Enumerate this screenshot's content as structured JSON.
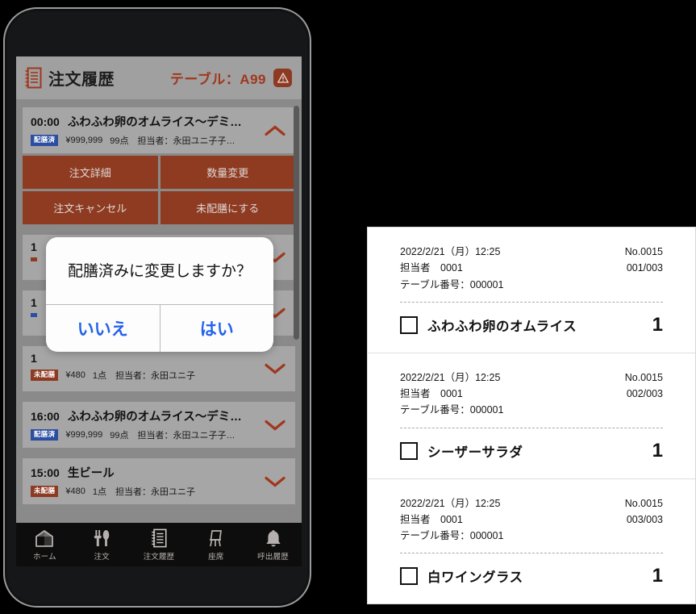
{
  "app": {
    "title": "注文履歴",
    "table_label": "テーブル：A99",
    "notebook_icon": "notebook-icon",
    "alert_icon": "warning-triangle-icon"
  },
  "orders": [
    {
      "time": "00:00",
      "name": "ふわふわ卵のオムライス～デミ…",
      "status": "配膳済",
      "status_type": "served",
      "price": "¥999,999",
      "count": "99点",
      "staff": "担当者：永田ユニ子子…",
      "expanded": true,
      "chevron": "chevron-up-icon",
      "actions": [
        "注文詳細",
        "数量変更",
        "注文キャンセル",
        "未配膳にする"
      ]
    },
    {
      "time": "1",
      "name": "",
      "status": "",
      "status_type": "unserved",
      "price": "",
      "count": "",
      "staff": "",
      "expanded": false,
      "chevron": "chevron-down-icon",
      "actions": []
    },
    {
      "time": "1",
      "name": "",
      "status": "",
      "status_type": "served",
      "price": "",
      "count": "",
      "staff": "",
      "expanded": false,
      "chevron": "chevron-down-icon",
      "actions": []
    },
    {
      "time": "1",
      "name": "",
      "status": "未配膳",
      "status_type": "unserved",
      "price": "¥480",
      "count": "1点",
      "staff": "担当者：永田ユニ子",
      "expanded": false,
      "chevron": "chevron-down-icon",
      "actions": []
    },
    {
      "time": "16:00",
      "name": "ふわふわ卵のオムライス～デミ…",
      "status": "配膳済",
      "status_type": "served",
      "price": "¥999,999",
      "count": "99点",
      "staff": "担当者：永田ユニ子子…",
      "expanded": false,
      "chevron": "chevron-down-icon",
      "actions": []
    },
    {
      "time": "15:00",
      "name": "生ビール",
      "status": "未配膳",
      "status_type": "unserved",
      "price": "¥480",
      "count": "1点",
      "staff": "担当者：永田ユニ子",
      "expanded": false,
      "chevron": "chevron-down-icon",
      "actions": []
    }
  ],
  "modal": {
    "message": "配膳済みに変更しますか？",
    "no_label": "いいえ",
    "yes_label": "はい"
  },
  "bottom_nav": [
    {
      "label": "ホーム",
      "icon": "home-icon"
    },
    {
      "label": "注文",
      "icon": "cutlery-icon"
    },
    {
      "label": "注文履歴",
      "icon": "notebook-icon"
    },
    {
      "label": "座席",
      "icon": "chair-icon"
    },
    {
      "label": "呼出履歴",
      "icon": "bell-icon"
    }
  ],
  "receipts": [
    {
      "datetime": "2022/2/21（月）12:25",
      "staff": "担当者　0001",
      "table": "テーブル番号：000001",
      "order_no": "No.0015",
      "page": "001/003",
      "item": "ふわふわ卵のオムライス",
      "qty": "1"
    },
    {
      "datetime": "2022/2/21（月）12:25",
      "staff": "担当者　0001",
      "table": "テーブル番号：000001",
      "order_no": "No.0015",
      "page": "002/003",
      "item": "シーザーサラダ",
      "qty": "1"
    },
    {
      "datetime": "2022/2/21（月）12:25",
      "staff": "担当者　0001",
      "table": "テーブル番号：000001",
      "order_no": "No.0015",
      "page": "003/003",
      "item": "白ワイングラス",
      "qty": "1"
    }
  ],
  "colors": {
    "brand_brown": "#8f3b21",
    "served_blue": "#2b4ea2",
    "link_blue": "#2563eb",
    "screen_bg": "#8a8a8a"
  }
}
